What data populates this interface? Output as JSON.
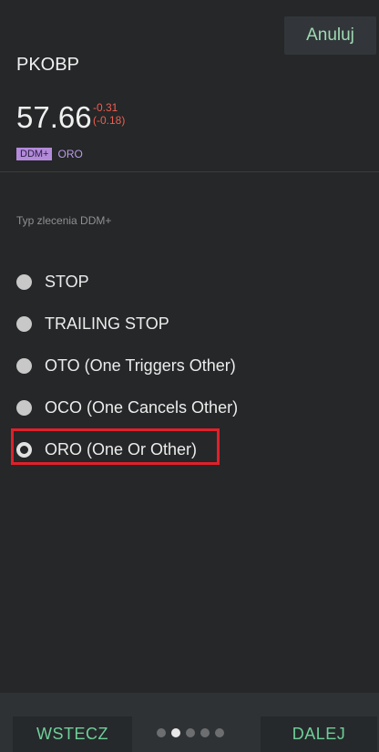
{
  "header": {
    "cancel_label": "Anuluj",
    "symbol": "PKOBP",
    "price": "57.66",
    "change_abs": "-0.31",
    "change_pct": "(-0.18)",
    "tag_primary": "DDM+",
    "tag_secondary": "ORO"
  },
  "section": {
    "label": "Typ zlecenia DDM+"
  },
  "options": [
    {
      "label": "STOP",
      "selected": false
    },
    {
      "label": "TRAILING STOP",
      "selected": false
    },
    {
      "label": "OTO (One Triggers Other)",
      "selected": false
    },
    {
      "label": "OCO (One Cancels Other)",
      "selected": false
    },
    {
      "label": "ORO (One Or Other)",
      "selected": true
    }
  ],
  "footer": {
    "back_label": "WSTECZ",
    "next_label": "DALEJ",
    "step_current": 2,
    "step_total": 5
  },
  "colors": {
    "accent_green": "#6fcf9a",
    "change_red": "#ee5e50",
    "tag_purple": "#b48adb",
    "highlight_red": "#e0202a"
  }
}
